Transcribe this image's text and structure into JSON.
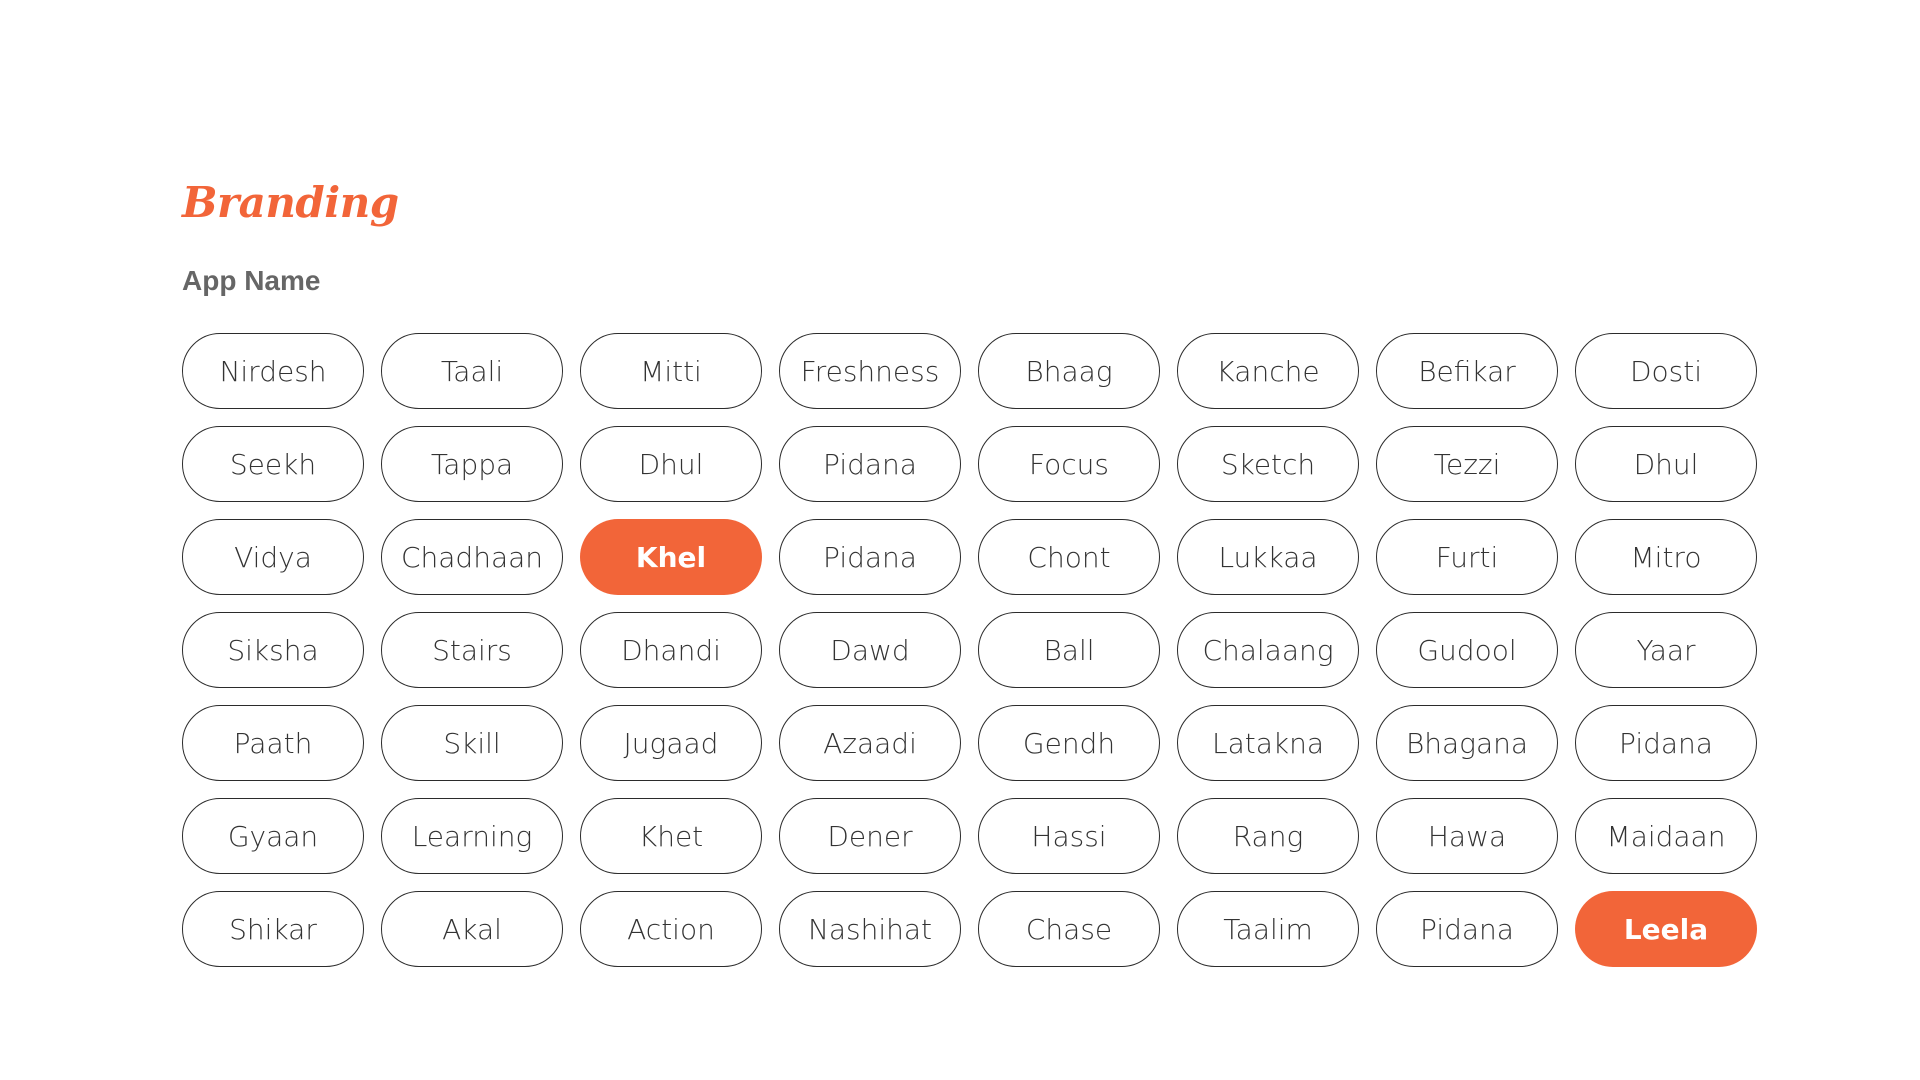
{
  "branding": {
    "title": "Branding",
    "subtitle": "App Name"
  },
  "colors": {
    "accent": "#F26539",
    "outline": "#2B2B2B",
    "text": "#333333",
    "subtitle": "#666666",
    "background": "#FFFFFF"
  },
  "names": [
    {
      "label": "Nirdesh",
      "selected": false
    },
    {
      "label": "Taali",
      "selected": false
    },
    {
      "label": "Mitti",
      "selected": false
    },
    {
      "label": "Freshness",
      "selected": false
    },
    {
      "label": "Bhaag",
      "selected": false
    },
    {
      "label": "Kanche",
      "selected": false
    },
    {
      "label": "Befikar",
      "selected": false
    },
    {
      "label": "Dosti",
      "selected": false
    },
    {
      "label": "Seekh",
      "selected": false
    },
    {
      "label": "Tappa",
      "selected": false
    },
    {
      "label": "Dhul",
      "selected": false
    },
    {
      "label": "Pidana",
      "selected": false
    },
    {
      "label": "Focus",
      "selected": false
    },
    {
      "label": "Sketch",
      "selected": false
    },
    {
      "label": "Tezzi",
      "selected": false
    },
    {
      "label": "Dhul",
      "selected": false
    },
    {
      "label": "Vidya",
      "selected": false
    },
    {
      "label": "Chadhaan",
      "selected": false
    },
    {
      "label": "Khel",
      "selected": true
    },
    {
      "label": "Pidana",
      "selected": false
    },
    {
      "label": "Chont",
      "selected": false
    },
    {
      "label": "Lukkaa",
      "selected": false
    },
    {
      "label": "Furti",
      "selected": false
    },
    {
      "label": "Mitro",
      "selected": false
    },
    {
      "label": "Siksha",
      "selected": false
    },
    {
      "label": "Stairs",
      "selected": false
    },
    {
      "label": "Dhandi",
      "selected": false
    },
    {
      "label": "Dawd",
      "selected": false
    },
    {
      "label": "Ball",
      "selected": false
    },
    {
      "label": "Chalaang",
      "selected": false
    },
    {
      "label": "Gudool",
      "selected": false
    },
    {
      "label": "Yaar",
      "selected": false
    },
    {
      "label": "Paath",
      "selected": false
    },
    {
      "label": "Skill",
      "selected": false
    },
    {
      "label": "Jugaad",
      "selected": false
    },
    {
      "label": "Azaadi",
      "selected": false
    },
    {
      "label": "Gendh",
      "selected": false
    },
    {
      "label": "Latakna",
      "selected": false
    },
    {
      "label": "Bhagana",
      "selected": false
    },
    {
      "label": "Pidana",
      "selected": false
    },
    {
      "label": "Gyaan",
      "selected": false
    },
    {
      "label": "Learning",
      "selected": false
    },
    {
      "label": "Khet",
      "selected": false
    },
    {
      "label": "Dener",
      "selected": false
    },
    {
      "label": "Hassi",
      "selected": false
    },
    {
      "label": "Rang",
      "selected": false
    },
    {
      "label": "Hawa",
      "selected": false
    },
    {
      "label": "Maidaan",
      "selected": false
    },
    {
      "label": "Shikar",
      "selected": false
    },
    {
      "label": "Akal",
      "selected": false
    },
    {
      "label": "Action",
      "selected": false
    },
    {
      "label": "Nashihat",
      "selected": false
    },
    {
      "label": "Chase",
      "selected": false
    },
    {
      "label": "Taalim",
      "selected": false
    },
    {
      "label": "Pidana",
      "selected": false
    },
    {
      "label": "Leela",
      "selected": true
    }
  ]
}
